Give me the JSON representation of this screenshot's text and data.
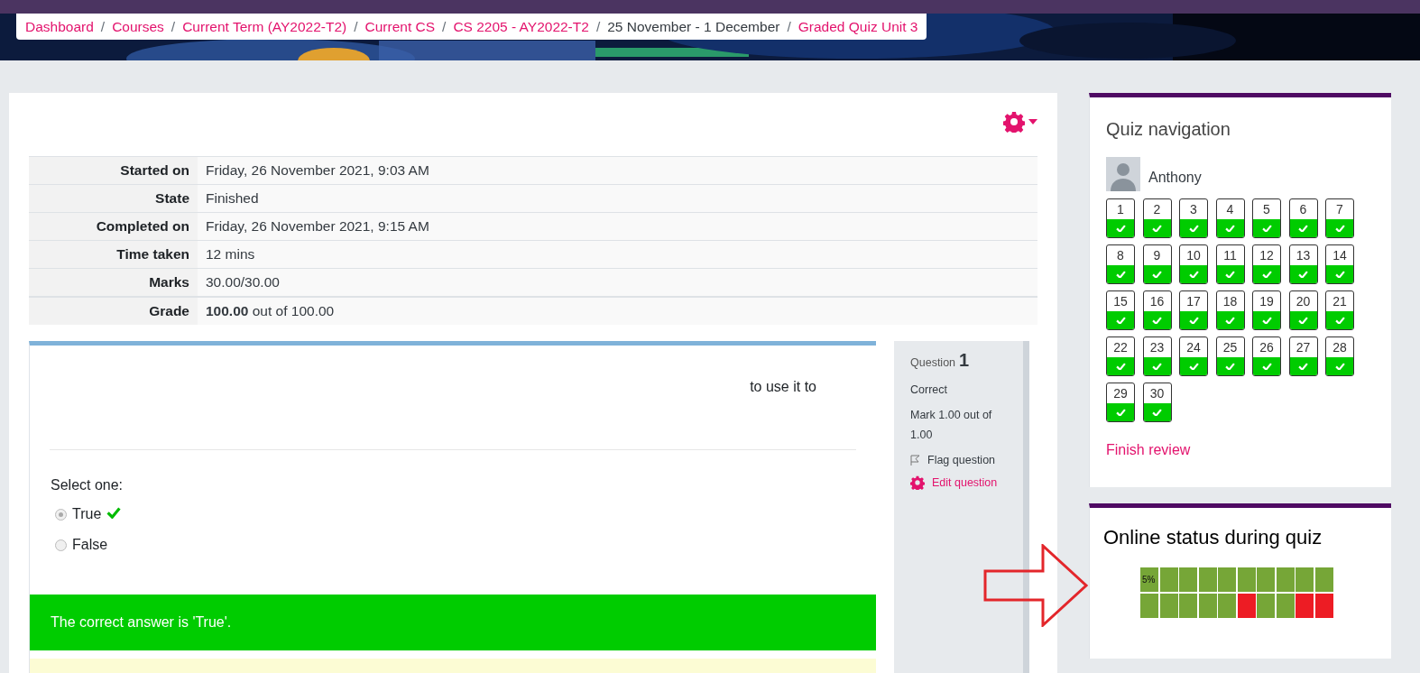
{
  "breadcrumb": [
    {
      "label": "Dashboard",
      "link": true
    },
    {
      "separator": "/",
      "label": "Courses",
      "link": true
    },
    {
      "separator": "/",
      "label": "Current Term (AY2022-T2)",
      "link": true
    },
    {
      "separator": "/",
      "label": "Current CS",
      "link": true
    },
    {
      "separator": "/",
      "label": "CS 2205 - AY2022-T2",
      "link": true
    },
    {
      "separator": "/",
      "label": "25 November - 1 December",
      "link": false
    },
    {
      "separator": "/",
      "label": "Graded Quiz Unit 3",
      "link": true
    }
  ],
  "summary": [
    {
      "label": "Started on",
      "value": "Friday, 26 November 2021, 9:03 AM"
    },
    {
      "label": "State",
      "value": "Finished"
    },
    {
      "label": "Completed on",
      "value": "Friday, 26 November 2021, 9:15 AM"
    },
    {
      "label": "Time taken",
      "value": "12 mins"
    },
    {
      "label": "Marks",
      "value": "30.00/30.00"
    },
    {
      "label": "Grade",
      "value": "**100.00** out of 100.00"
    }
  ],
  "question": {
    "label": "Question",
    "number": "1",
    "status": "Correct",
    "mark": "Mark 1.00 out of 1.00",
    "flag": "Flag question",
    "edit": "Edit question",
    "text": "to use it to",
    "prompt": "Select one:",
    "options": [
      {
        "label": "True",
        "selected": true,
        "correct": true
      },
      {
        "label": "False",
        "selected": false,
        "correct": false
      }
    ],
    "feedback": "The correct answer is 'True'."
  },
  "quiz_navigation": {
    "title": "Quiz navigation",
    "user": "Anthony",
    "finish": "Finish review",
    "questions": [
      {
        "number": "1",
        "correct": true
      },
      {
        "number": "2",
        "correct": true
      },
      {
        "number": "3",
        "correct": true
      },
      {
        "number": "4",
        "correct": true
      },
      {
        "number": "5",
        "correct": true
      },
      {
        "number": "6",
        "correct": true
      },
      {
        "number": "7",
        "correct": true
      },
      {
        "number": "8",
        "correct": true
      },
      {
        "number": "9",
        "correct": true
      },
      {
        "number": "10",
        "correct": true
      },
      {
        "number": "11",
        "correct": true
      },
      {
        "number": "12",
        "correct": true
      },
      {
        "number": "13",
        "correct": true
      },
      {
        "number": "14",
        "correct": true
      },
      {
        "number": "15",
        "correct": true
      },
      {
        "number": "16",
        "correct": true
      },
      {
        "number": "17",
        "correct": true
      },
      {
        "number": "18",
        "correct": true
      },
      {
        "number": "19",
        "correct": true
      },
      {
        "number": "20",
        "correct": true
      },
      {
        "number": "21",
        "correct": true
      },
      {
        "number": "22",
        "correct": true
      },
      {
        "number": "23",
        "correct": true
      },
      {
        "number": "24",
        "correct": true
      },
      {
        "number": "25",
        "correct": true
      },
      {
        "number": "26",
        "correct": true
      },
      {
        "number": "27",
        "correct": true
      },
      {
        "number": "28",
        "correct": true
      },
      {
        "number": "29",
        "correct": true
      },
      {
        "number": "30",
        "correct": true
      }
    ]
  },
  "online_status": {
    "title": "Online status during quiz",
    "label": "5%",
    "cells": [
      {
        "color": "#76a637"
      },
      {
        "color": "#76a637"
      },
      {
        "color": "#76a637"
      },
      {
        "color": "#76a637"
      },
      {
        "color": "#76a637"
      },
      {
        "color": "#76a637"
      },
      {
        "color": "#76a637"
      },
      {
        "color": "#76a637"
      },
      {
        "color": "#76a637"
      },
      {
        "color": "#76a637"
      },
      {
        "color": "#76a637"
      },
      {
        "color": "#76a637"
      },
      {
        "color": "#76a637"
      },
      {
        "color": "#76a637"
      },
      {
        "color": "#76a637"
      },
      {
        "color": "#ed1c24"
      },
      {
        "color": "#76a637"
      },
      {
        "color": "#76a637"
      },
      {
        "color": "#ed1c24"
      },
      {
        "color": "#ed1c24"
      }
    ]
  }
}
